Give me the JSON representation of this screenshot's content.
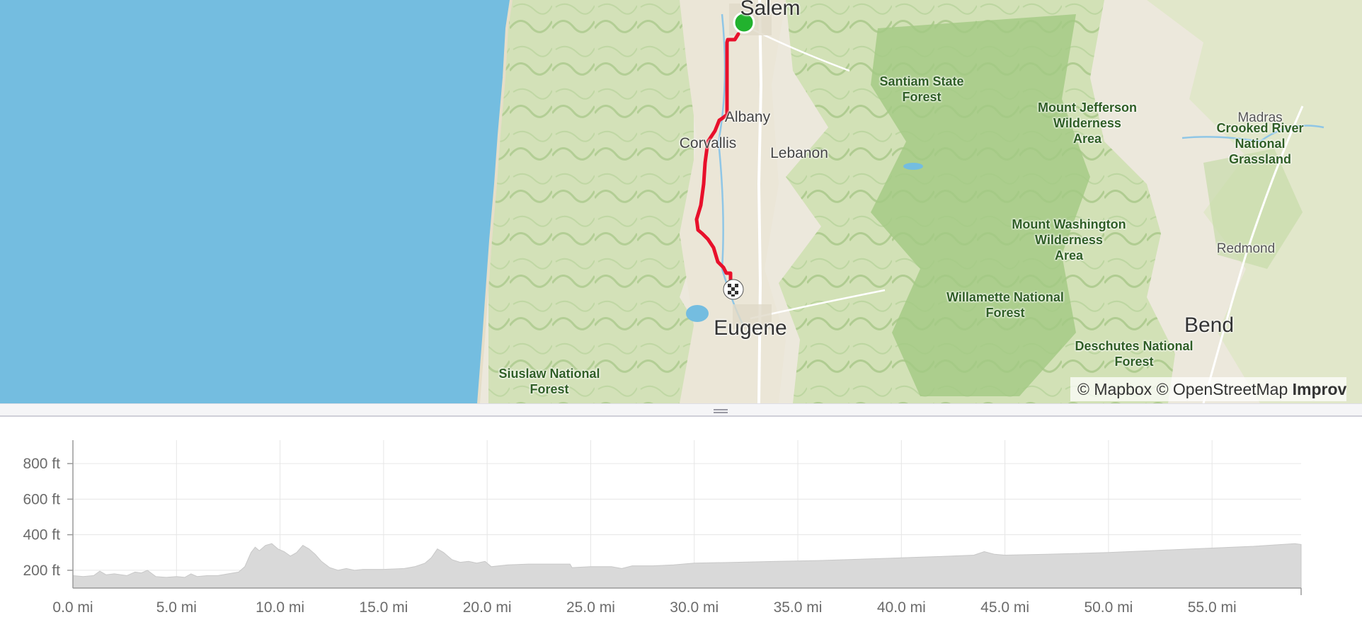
{
  "map": {
    "cities": {
      "salem": "Salem",
      "albany": "Albany",
      "corvallis": "Corvallis",
      "lebanon": "Lebanon",
      "eugene": "Eugene",
      "madras": "Madras",
      "redmond": "Redmond",
      "bend": "Bend"
    },
    "parks": {
      "santiam": "Santiam State\nForest",
      "mount_jefferson": "Mount Jefferson\nWilderness\nArea",
      "crooked_river": "Crooked River\nNational Grassland",
      "mount_washington": "Mount Washington\nWilderness\nArea",
      "willamette": "Willamette National\nForest",
      "deschutes": "Deschutes National\nForest",
      "siuslaw": "Siuslaw National\nForest"
    },
    "attribution": {
      "mapbox": "© Mapbox",
      "osm": "© OpenStreetMap",
      "improve": "Improv"
    },
    "colors": {
      "water": "#74bde0",
      "land": "#ece8dc",
      "forest": "#b9d89a",
      "route": "#e8102b",
      "start_marker": "#22b22e"
    },
    "markers": [
      "start-marker",
      "finish-marker"
    ]
  },
  "chart_data": {
    "type": "area",
    "title": "",
    "xlabel": "",
    "ylabel": "",
    "x_unit": "mi",
    "y_unit": "ft",
    "xlim": [
      0,
      59.3
    ],
    "ylim": [
      100,
      900
    ],
    "x_ticks": [
      "0.0 mi",
      "5.0 mi",
      "10.0 mi",
      "15.0 mi",
      "20.0 mi",
      "25.0 mi",
      "30.0 mi",
      "35.0 mi",
      "40.0 mi",
      "45.0 mi",
      "50.0 mi",
      "55.0 mi"
    ],
    "y_ticks": [
      "200 ft",
      "400 ft",
      "600 ft",
      "800 ft"
    ],
    "grid": true,
    "fill_color": "#d9d9d9",
    "series": [
      {
        "x": [
          0,
          0.5,
          1.0,
          1.3,
          1.6,
          2.0,
          2.6,
          3.0,
          3.3,
          3.6,
          4.0,
          4.5,
          5.0,
          5.4,
          5.7,
          6.0,
          6.5,
          7.0,
          7.5,
          8.0,
          8.3,
          8.6,
          8.8,
          9.0,
          9.3,
          9.6,
          9.9,
          10.2,
          10.5,
          10.8,
          11.1,
          11.4,
          11.7,
          12.0,
          12.4,
          12.8,
          13.2,
          13.6,
          14.0,
          15.0,
          16.0,
          16.5,
          17.0,
          17.3,
          17.6,
          17.9,
          18.3,
          18.7,
          19.1,
          19.5,
          19.9,
          20.2,
          21.0,
          22.0,
          23.0,
          24.0,
          24.1,
          25.0,
          26.0,
          26.5,
          27.0,
          28.0,
          29.0,
          30.0,
          32.0,
          34.0,
          36.0,
          38.0,
          40.0,
          42.0,
          43.5,
          44.0,
          44.5,
          45.0,
          47.0,
          50.0,
          52.0,
          55.0,
          57.0,
          59.0,
          59.3
        ],
        "y": [
          170,
          165,
          170,
          195,
          175,
          180,
          170,
          190,
          185,
          200,
          165,
          160,
          165,
          160,
          180,
          165,
          170,
          170,
          180,
          190,
          220,
          300,
          330,
          310,
          340,
          350,
          320,
          305,
          280,
          300,
          340,
          320,
          290,
          250,
          215,
          200,
          210,
          200,
          205,
          205,
          210,
          220,
          240,
          270,
          320,
          300,
          260,
          245,
          250,
          240,
          250,
          220,
          230,
          235,
          235,
          235,
          215,
          220,
          220,
          210,
          225,
          225,
          230,
          240,
          245,
          250,
          255,
          262,
          270,
          278,
          285,
          305,
          290,
          285,
          290,
          300,
          310,
          325,
          335,
          350,
          345
        ]
      }
    ]
  }
}
